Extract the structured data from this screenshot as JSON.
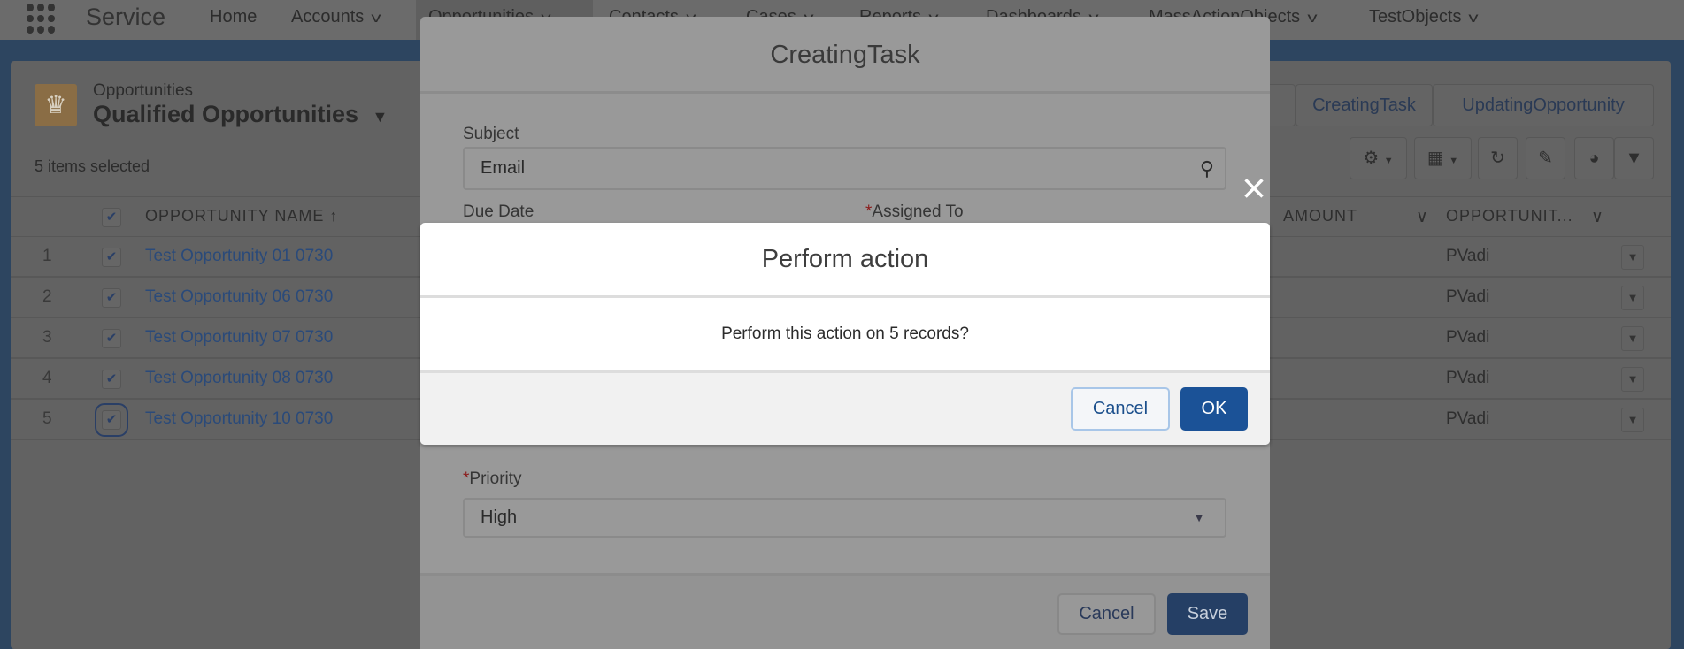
{
  "nav": {
    "app_name": "Service",
    "items": [
      {
        "label": "Home",
        "has_menu": false
      },
      {
        "label": "Accounts",
        "has_menu": true
      },
      {
        "label": "Opportunities",
        "has_menu": true
      },
      {
        "label": "Contacts",
        "has_menu": true
      },
      {
        "label": "Cases",
        "has_menu": true
      },
      {
        "label": "Reports",
        "has_menu": true
      },
      {
        "label": "Dashboards",
        "has_menu": true
      },
      {
        "label": "MassActionObjects",
        "has_menu": true
      },
      {
        "label": "TestObjects",
        "has_menu": true
      }
    ]
  },
  "list_view": {
    "object_label": "Opportunities",
    "view_name": "Qualified Opportunities",
    "status": "5 items selected",
    "actions": [
      "CreatingTask",
      "UpdatingOpportunity"
    ],
    "columns": {
      "name": "OPPORTUNITY NAME",
      "amount": "AMOUNT",
      "owner": "OPPORTUNIT..."
    },
    "rows": [
      {
        "num": "1",
        "name": "Test Opportunity 01 0730",
        "owner": "PVadi",
        "checked": true
      },
      {
        "num": "2",
        "name": "Test Opportunity 06 0730",
        "owner": "PVadi",
        "checked": true
      },
      {
        "num": "3",
        "name": "Test Opportunity 07 0730",
        "owner": "PVadi",
        "checked": true
      },
      {
        "num": "4",
        "name": "Test Opportunity 08 0730",
        "owner": "PVadi",
        "checked": true
      },
      {
        "num": "5",
        "name": "Test Opportunity 10 0730",
        "owner": "PVadi",
        "checked": true
      }
    ]
  },
  "task_modal": {
    "title": "CreatingTask",
    "subject_label": "Subject",
    "subject_value": "Email",
    "due_date_label": "Due Date",
    "assigned_to_label": "Assigned To",
    "priority_label": "Priority",
    "priority_value": "High",
    "required_marker": "*",
    "cancel_label": "Cancel",
    "save_label": "Save"
  },
  "confirm_dialog": {
    "title": "Perform action",
    "message": "Perform this action on 5 records?",
    "cancel_label": "Cancel",
    "ok_label": "OK",
    "close_icon": "×"
  },
  "colors": {
    "primary": "#1b5297",
    "link": "#2a4a7a",
    "required": "#8b1a1a"
  }
}
